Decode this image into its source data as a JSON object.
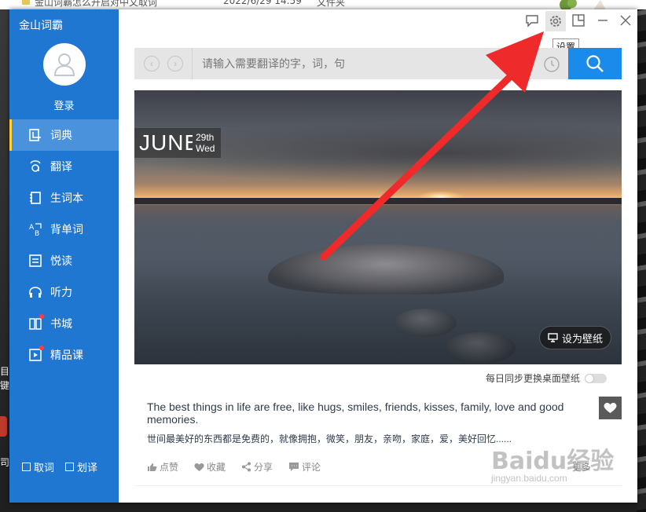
{
  "explorer_row": {
    "file_name": "金山词霸怎么开启对中文取词",
    "date": "2022/6/29 14:59",
    "type": "文件夹"
  },
  "left_edge": {
    "chars": [
      "目",
      "键",
      "司"
    ]
  },
  "app": {
    "title": "金山词霸",
    "login_label": "登录",
    "nav": [
      {
        "label": "词典",
        "icon": "dictionary-icon",
        "active": true
      },
      {
        "label": "翻译",
        "icon": "translate-icon"
      },
      {
        "label": "生词本",
        "icon": "wordbook-icon"
      },
      {
        "label": "背单词",
        "icon": "memorize-icon"
      },
      {
        "label": "悦读",
        "icon": "reading-icon"
      },
      {
        "label": "听力",
        "icon": "headphones-icon"
      },
      {
        "label": "书城",
        "icon": "bookstore-icon",
        "dot": true
      },
      {
        "label": "精品课",
        "icon": "course-icon",
        "dot": true
      }
    ],
    "bottom": {
      "pick_word": "取词",
      "select_translate": "划译"
    }
  },
  "window_controls": {
    "tooltip": "设置",
    "icons": [
      "feedback-icon",
      "settings-icon",
      "mini-mode-icon",
      "minimize-icon",
      "close-icon"
    ]
  },
  "search": {
    "placeholder": "请输入需要翻译的字，词，句",
    "value": ""
  },
  "daily": {
    "month": "JUNE",
    "day": "29th",
    "weekday": "Wed",
    "set_wallpaper": "设为壁纸",
    "sync_label": "每日同步更换桌面壁纸",
    "sync_on": false,
    "quote_en": "The best things in life are free, like hugs, smiles, friends, kisses, family, love and good memories.",
    "quote_cn": "世间最美好的东西都是免费的，就像拥抱，微笑，朋友，亲吻，家庭，爱，美好回忆......",
    "actions": {
      "like": "点赞",
      "collect": "收藏",
      "share": "分享",
      "comment": "评论",
      "more": "更多"
    }
  },
  "watermark": {
    "logo": "Baidu经验",
    "url": "jingyan.baidu.com"
  },
  "colors": {
    "sidebar": "#1f77d1",
    "active_nav": "#4a92dc",
    "active_marker": "#ffd336",
    "search_button": "#1a8bea",
    "arrow": "#ee2a2a"
  }
}
